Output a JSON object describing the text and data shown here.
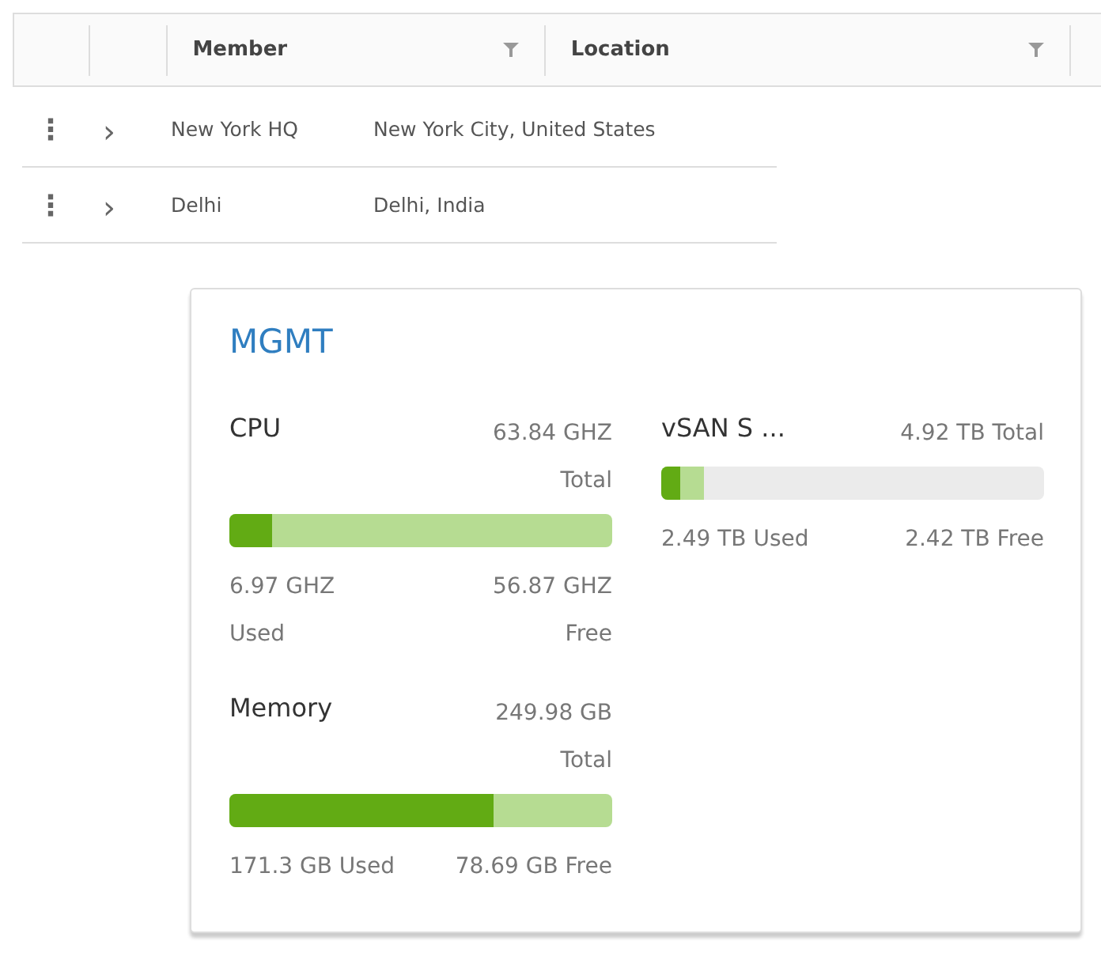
{
  "table": {
    "columns": [
      {
        "label": "Member"
      },
      {
        "label": "Location"
      }
    ],
    "rows": [
      {
        "menu": "⋮",
        "expander": "›",
        "member": "New York HQ",
        "location": "New York City, United States"
      },
      {
        "menu": "⋮",
        "expander": "›",
        "member": "Delhi",
        "location": "Delhi, India"
      }
    ]
  },
  "card": {
    "title": "MGMT",
    "meters": [
      {
        "name": "CPU",
        "kind": "wrapped",
        "total": "63.84 GHZ Total",
        "level": 0.11,
        "used": "6.97 GHZ Used",
        "free": "56.87 GHZ Free",
        "free_filled": true
      },
      {
        "name": "vSAN S ...",
        "kind": "inline",
        "total": "4.92 TB Total",
        "level": 0.05,
        "used": "2.49 TB Used",
        "free": "2.42 TB Free",
        "free_filled": false,
        "secondary": {
          "level": 0.11
        }
      },
      {
        "name": "Memory",
        "kind": "wrapped",
        "total": "249.98 GB Total",
        "level": 0.69,
        "used": "171.3 GB Used",
        "free": "78.69 GB Free",
        "free_filled": true
      }
    ]
  }
}
